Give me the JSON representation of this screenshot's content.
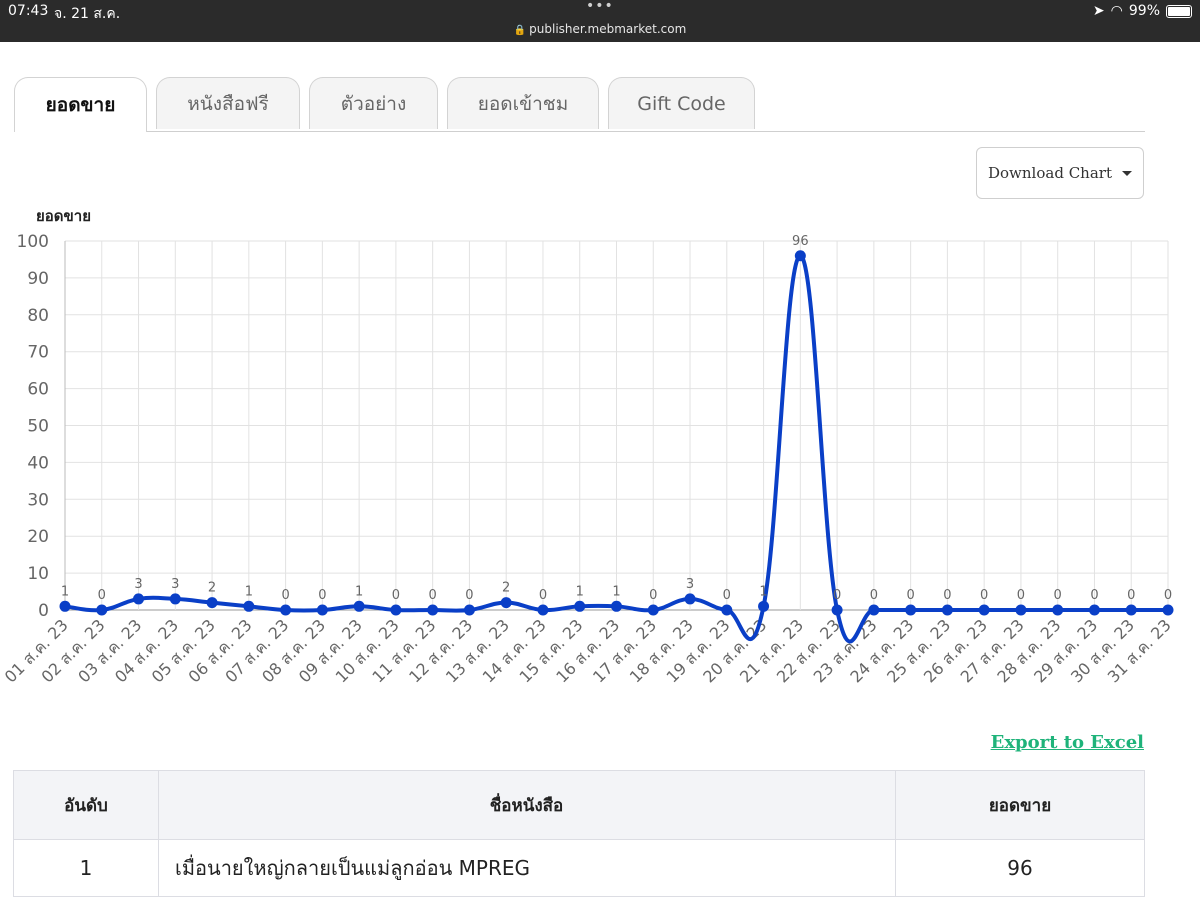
{
  "status_bar": {
    "time": "07:43",
    "date": "จ. 21 ส.ค.",
    "url": "publisher.mebmarket.com",
    "battery": "99%"
  },
  "tabs": [
    {
      "label": "ยอดขาย",
      "active": true
    },
    {
      "label": "หนังสือฟรี",
      "active": false
    },
    {
      "label": "ตัวอย่าง",
      "active": false
    },
    {
      "label": "ยอดเข้าชม",
      "active": false
    },
    {
      "label": "Gift Code",
      "active": false
    }
  ],
  "download_button": {
    "label": "Download Chart"
  },
  "chart_data": {
    "type": "line",
    "ylabel": "ยอดขาย",
    "ylim": [
      0,
      100
    ],
    "yticks": [
      0,
      10,
      20,
      30,
      40,
      50,
      60,
      70,
      80,
      90,
      100
    ],
    "categories": [
      "01 ส.ค. 23",
      "02 ส.ค. 23",
      "03 ส.ค. 23",
      "04 ส.ค. 23",
      "05 ส.ค. 23",
      "06 ส.ค. 23",
      "07 ส.ค. 23",
      "08 ส.ค. 23",
      "09 ส.ค. 23",
      "10 ส.ค. 23",
      "11 ส.ค. 23",
      "12 ส.ค. 23",
      "13 ส.ค. 23",
      "14 ส.ค. 23",
      "15 ส.ค. 23",
      "16 ส.ค. 23",
      "17 ส.ค. 23",
      "18 ส.ค. 23",
      "19 ส.ค. 23",
      "20 ส.ค. 23",
      "21 ส.ค. 23",
      "22 ส.ค. 23",
      "23 ส.ค. 23",
      "24 ส.ค. 23",
      "25 ส.ค. 23",
      "26 ส.ค. 23",
      "27 ส.ค. 23",
      "28 ส.ค. 23",
      "29 ส.ค. 23",
      "30 ส.ค. 23",
      "31 ส.ค. 23"
    ],
    "values": [
      1,
      0,
      3,
      3,
      2,
      1,
      0,
      0,
      1,
      0,
      0,
      0,
      2,
      0,
      1,
      1,
      0,
      3,
      0,
      1,
      96,
      0,
      0,
      0,
      0,
      0,
      0,
      0,
      0,
      0,
      0
    ],
    "grid": true,
    "line_color": "#0a3fc7"
  },
  "export_link": {
    "label": "Export to Excel",
    "color": "#1fb37a"
  },
  "table": {
    "headers": {
      "rank": "อันดับ",
      "name": "ชื่อหนังสือ",
      "sales": "ยอดขาย"
    },
    "rows": [
      {
        "rank": "1",
        "name": "เมื่อนายใหญ่กลายเป็นแม่ลูกอ่อน MPREG",
        "sales": "96"
      }
    ]
  }
}
